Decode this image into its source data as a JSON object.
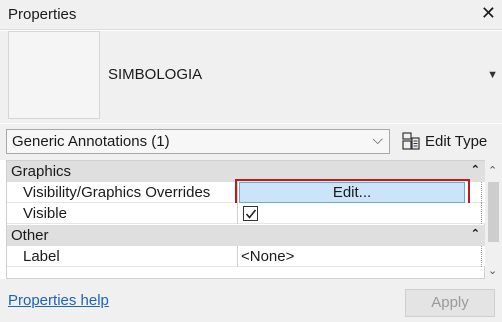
{
  "window": {
    "title": "Properties",
    "close_icon": "close-icon"
  },
  "type_selector": {
    "name": "SIMBOLOGIA",
    "dropdown_icon": "triangle-down-icon"
  },
  "instance_filter": {
    "selected": "Generic Annotations (1)",
    "chevron_icon": "chevron-down-icon"
  },
  "edit_type": {
    "label": "Edit Type",
    "icon": "edit-type-icon"
  },
  "groups": [
    {
      "label": "Graphics",
      "params": [
        {
          "name": "Visibility/Graphics Overrides",
          "value": "Edit..."
        },
        {
          "name": "Visible",
          "value": true
        }
      ]
    },
    {
      "label": "Other",
      "params": [
        {
          "name": "Label",
          "value": "<None>"
        }
      ]
    }
  ],
  "footer": {
    "help_link": "Properties help",
    "apply_label": "Apply"
  },
  "colors": {
    "highlight": "#b41f1f",
    "button_blue": "#cce4f7",
    "link": "#1f63b5"
  }
}
